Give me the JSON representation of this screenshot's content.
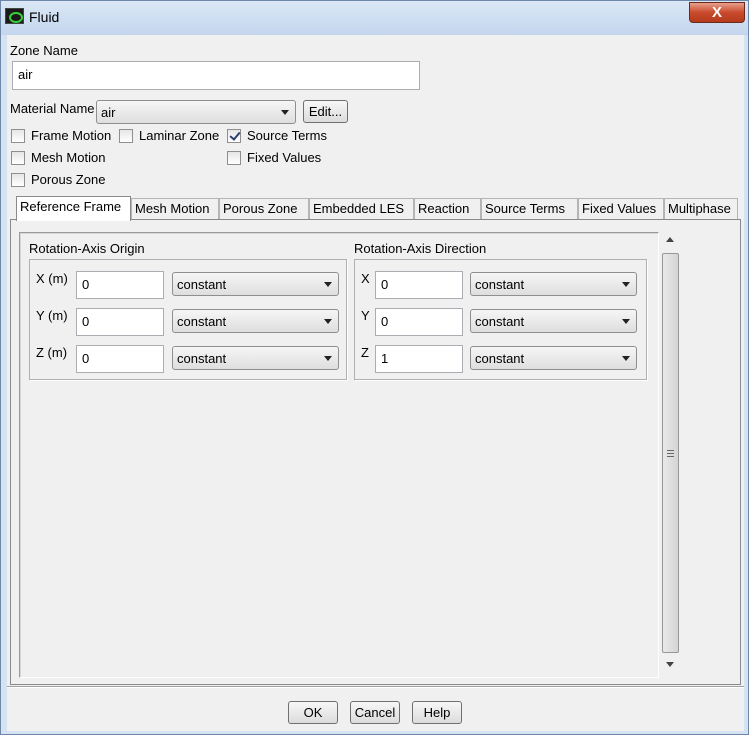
{
  "window": {
    "title": "Fluid",
    "close_label": "X"
  },
  "zone": {
    "label": "Zone Name",
    "value": "air"
  },
  "material": {
    "label": "Material Name",
    "value": "air",
    "edit_label": "Edit..."
  },
  "options": {
    "frame_motion": {
      "label": "Frame Motion",
      "checked": false
    },
    "laminar_zone": {
      "label": "Laminar Zone",
      "checked": false
    },
    "source_terms": {
      "label": "Source Terms",
      "checked": true
    },
    "mesh_motion": {
      "label": "Mesh Motion",
      "checked": false
    },
    "fixed_values": {
      "label": "Fixed Values",
      "checked": false
    },
    "porous_zone": {
      "label": "Porous Zone",
      "checked": false
    }
  },
  "tabs": [
    {
      "label": "Reference Frame",
      "active": true
    },
    {
      "label": "Mesh Motion",
      "active": false
    },
    {
      "label": "Porous Zone",
      "active": false
    },
    {
      "label": "Embedded LES",
      "active": false
    },
    {
      "label": "Reaction",
      "active": false
    },
    {
      "label": "Source Terms",
      "active": false
    },
    {
      "label": "Fixed Values",
      "active": false
    },
    {
      "label": "Multiphase",
      "active": false
    }
  ],
  "origin": {
    "title": "Rotation-Axis Origin",
    "rows": [
      {
        "label": "X (m)",
        "value": "0",
        "method": "constant"
      },
      {
        "label": "Y (m)",
        "value": "0",
        "method": "constant"
      },
      {
        "label": "Z (m)",
        "value": "0",
        "method": "constant"
      }
    ]
  },
  "direction": {
    "title": "Rotation-Axis Direction",
    "rows": [
      {
        "label": "X",
        "value": "0",
        "method": "constant"
      },
      {
        "label": "Y",
        "value": "0",
        "method": "constant"
      },
      {
        "label": "Z",
        "value": "1",
        "method": "constant"
      }
    ]
  },
  "buttons": {
    "ok": "OK",
    "cancel": "Cancel",
    "help": "Help"
  }
}
